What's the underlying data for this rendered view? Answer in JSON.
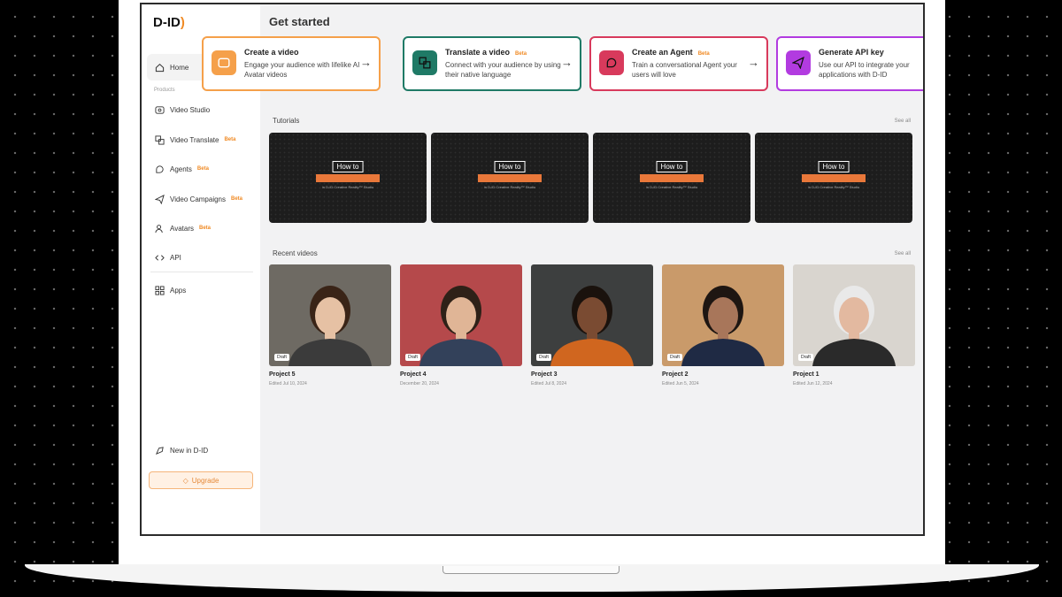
{
  "brand": {
    "logo": "D-ID",
    "accent": "#f08a24"
  },
  "sidebar": {
    "home": "Home",
    "products_label": "Products",
    "items": [
      {
        "label": "Video Studio",
        "badge": "",
        "icon": "video-icon"
      },
      {
        "label": "Video Translate",
        "badge": "Beta",
        "icon": "translate-icon"
      },
      {
        "label": "Agents",
        "badge": "Beta",
        "icon": "agent-icon"
      },
      {
        "label": "Video Campaigns",
        "badge": "Beta",
        "icon": "send-icon"
      },
      {
        "label": "Avatars",
        "badge": "Beta",
        "icon": "avatar-icon"
      },
      {
        "label": "API",
        "badge": "",
        "icon": "code-icon"
      },
      {
        "label": "Apps",
        "badge": "",
        "icon": "grid-icon"
      }
    ],
    "new_in": "New in D-ID",
    "upgrade": "Upgrade"
  },
  "main": {
    "title": "Get started",
    "cards": [
      {
        "title": "Create a video",
        "badge": "",
        "desc": "Engage your audience with lifelike AI Avatar videos",
        "color": "#f5a04a",
        "icon": "video-icon"
      },
      {
        "title": "Translate a video",
        "badge": "Beta",
        "desc": "Connect with your audience by using their native language",
        "color": "#1f7a66",
        "icon": "translate-icon"
      },
      {
        "title": "Create an Agent",
        "badge": "Beta",
        "desc": "Train a conversational Agent your users will love",
        "color": "#d83a5c",
        "icon": "agent-icon"
      },
      {
        "title": "Generate API key",
        "badge": "",
        "desc": "Use our API to integrate your applications with D-ID",
        "color": "#b23be0",
        "icon": "send-icon"
      }
    ],
    "tutorials": {
      "title": "Tutorials",
      "see_all": "See all",
      "items": [
        {
          "howto": "How to",
          "subtitle": "in D-ID Creative Reality™ Studio"
        },
        {
          "howto": "How to",
          "subtitle": "in D-ID Creative Reality™ Studio"
        },
        {
          "howto": "How to",
          "subtitle": "in D-ID Creative Reality™ Studio"
        },
        {
          "howto": "How to",
          "subtitle": "in D-ID Creative Reality™ Studio"
        }
      ]
    },
    "recent": {
      "title": "Recent videos",
      "see_all": "See all",
      "videos": [
        {
          "title": "Project 5",
          "status": "Draft",
          "date": "Edited Jul 10, 2024",
          "bg": "#6e6a63",
          "skin": "#e6c1a4",
          "hair": "#3a2417",
          "shirt": "#3b3b3b"
        },
        {
          "title": "Project 4",
          "status": "Draft",
          "date": "December 20, 2024",
          "bg": "#b5494b",
          "skin": "#e0b596",
          "hair": "#2e2118",
          "shirt": "#33415a"
        },
        {
          "title": "Project 3",
          "status": "Draft",
          "date": "Edited Jul 8, 2024",
          "bg": "#3d3f3f",
          "skin": "#7a4b32",
          "hair": "#1a120d",
          "shirt": "#d0661f"
        },
        {
          "title": "Project 2",
          "status": "Draft",
          "date": "Edited Jun 5, 2024",
          "bg": "#c99a6a",
          "skin": "#a8765a",
          "hair": "#1e1612",
          "shirt": "#1f2a44"
        },
        {
          "title": "Project 1",
          "status": "Draft",
          "date": "Edited Jun 12, 2024",
          "bg": "#d9d5cf",
          "skin": "#e3b9a0",
          "hair": "#e9e9e9",
          "shirt": "#2a2a2a"
        }
      ]
    }
  }
}
